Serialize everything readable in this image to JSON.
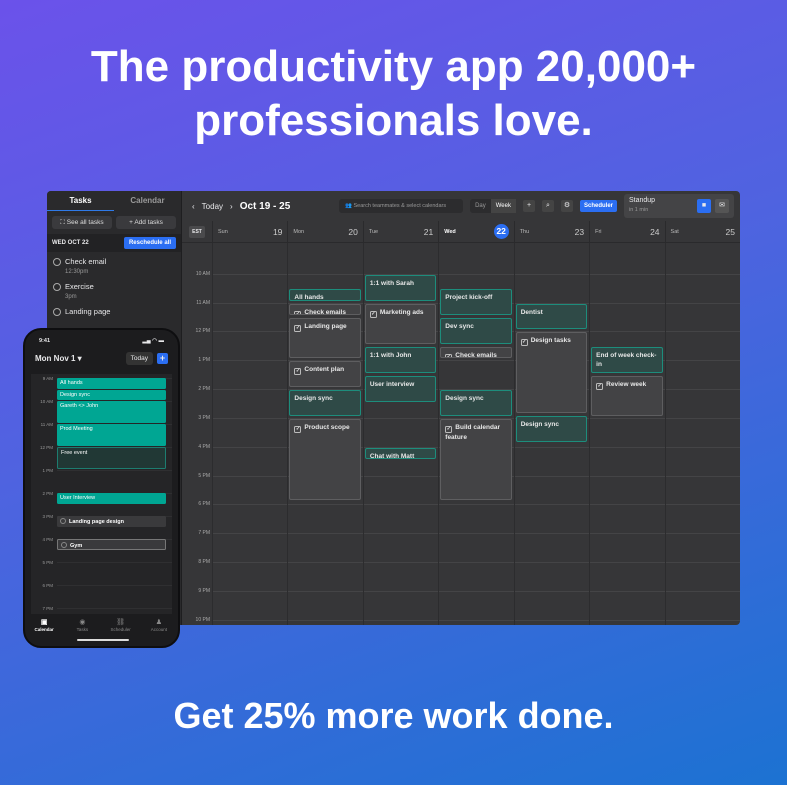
{
  "headline": [
    "The productivity app 20,000+",
    "professionals love."
  ],
  "footer": "Get 25% more work done.",
  "sidebar": {
    "tabs": [
      "Tasks",
      "Calendar"
    ],
    "see_all": "See all tasks",
    "add": "Add tasks",
    "date": "WED OCT 22",
    "reschedule": "Reschedule all",
    "tasks": [
      {
        "title": "Check email",
        "time": "12:30pm"
      },
      {
        "title": "Exercise",
        "time": "3pm"
      },
      {
        "title": "Landing page",
        "time": ""
      }
    ]
  },
  "toolbar": {
    "today": "Today",
    "range": "Oct 19 - 25",
    "search_placeholder": "Search teammates & select calendars",
    "day": "Day",
    "week": "Week",
    "scheduler": "Scheduler",
    "next_event": {
      "title": "Standup",
      "when": "in 1 min"
    }
  },
  "calendar": {
    "timezone": "EST",
    "days": [
      {
        "name": "Sun",
        "num": "19"
      },
      {
        "name": "Mon",
        "num": "20"
      },
      {
        "name": "Tue",
        "num": "21"
      },
      {
        "name": "Wed",
        "num": "22",
        "today": true
      },
      {
        "name": "Thu",
        "num": "23"
      },
      {
        "name": "Fri",
        "num": "24"
      },
      {
        "name": "Sat",
        "num": "25"
      }
    ],
    "hours": [
      "10 AM",
      "11 AM",
      "12 PM",
      "1 PM",
      "2 PM",
      "3 PM",
      "4 PM",
      "5 PM",
      "6 PM",
      "7 PM",
      "8 PM",
      "9 PM",
      "10 PM"
    ],
    "events": [
      {
        "day": 1,
        "title": "All hands",
        "start": 10.5,
        "end": 11,
        "kind": "meeting"
      },
      {
        "day": 1,
        "title": "Check emails",
        "start": 11,
        "end": 11.5,
        "kind": "task"
      },
      {
        "day": 1,
        "title": "Landing page",
        "start": 11.5,
        "end": 13,
        "kind": "task"
      },
      {
        "day": 1,
        "title": "Content plan",
        "start": 13,
        "end": 14,
        "kind": "task"
      },
      {
        "day": 1,
        "title": "Design sync",
        "start": 14,
        "end": 15,
        "kind": "meeting"
      },
      {
        "day": 1,
        "title": "Product scope",
        "start": 15,
        "end": 17.9,
        "kind": "task"
      },
      {
        "day": 2,
        "title": "1:1 with Sarah",
        "start": 10,
        "end": 11,
        "kind": "meeting"
      },
      {
        "day": 2,
        "title": "Marketing ads",
        "start": 11,
        "end": 12.5,
        "kind": "task"
      },
      {
        "day": 2,
        "title": "1:1 with John",
        "start": 12.5,
        "end": 13.5,
        "kind": "meeting"
      },
      {
        "day": 2,
        "title": "User interview",
        "start": 13.5,
        "end": 14.5,
        "kind": "meeting"
      },
      {
        "day": 2,
        "title": "Chat with Matt",
        "start": 16,
        "end": 16.5,
        "kind": "meeting"
      },
      {
        "day": 3,
        "title": "Project kick-off",
        "start": 10.5,
        "end": 11.5,
        "kind": "meeting"
      },
      {
        "day": 3,
        "title": "Dev sync",
        "start": 11.5,
        "end": 12.5,
        "kind": "meeting"
      },
      {
        "day": 3,
        "title": "Check emails",
        "start": 12.5,
        "end": 13,
        "kind": "task"
      },
      {
        "day": 3,
        "title": "Design sync",
        "start": 14,
        "end": 15,
        "kind": "meeting"
      },
      {
        "day": 3,
        "title": "Build calendar feature",
        "start": 15,
        "end": 17.9,
        "kind": "task"
      },
      {
        "day": 4,
        "title": "Dentist",
        "start": 11,
        "end": 12,
        "kind": "meeting"
      },
      {
        "day": 4,
        "title": "Design tasks",
        "start": 12,
        "end": 14.9,
        "kind": "task"
      },
      {
        "day": 4,
        "title": "Design sync",
        "start": 14.9,
        "end": 15.9,
        "kind": "meeting"
      },
      {
        "day": 5,
        "title": "End of week check-in",
        "start": 12.5,
        "end": 13.5,
        "kind": "meeting"
      },
      {
        "day": 5,
        "title": "Review week",
        "start": 13.5,
        "end": 15,
        "kind": "task"
      }
    ]
  },
  "phone": {
    "time": "9:41",
    "date": "Mon Nov 1",
    "today": "Today",
    "hours": [
      "9 AM",
      "10 AM",
      "11 AM",
      "12 PM",
      "1 PM",
      "2 PM",
      "3 PM",
      "4 PM",
      "5 PM",
      "6 PM",
      "7 PM"
    ],
    "events": [
      {
        "title": "All hands",
        "start": 9,
        "end": 9.5,
        "kind": "g"
      },
      {
        "title": "Design sync",
        "start": 9.5,
        "end": 10,
        "kind": "g"
      },
      {
        "title": "Gareth <> John",
        "start": 10,
        "end": 11,
        "kind": "g"
      },
      {
        "title": "Prod Meeting",
        "start": 11,
        "end": 12,
        "kind": "g"
      },
      {
        "title": "Free event",
        "start": 12,
        "end": 13,
        "kind": "f"
      },
      {
        "title": "User Interview",
        "start": 14,
        "end": 14.5,
        "kind": "g"
      },
      {
        "title": "Landing page design",
        "start": 15,
        "end": 15.5,
        "kind": "k"
      },
      {
        "title": "Gym",
        "start": 16,
        "end": 16.5,
        "kind": "k o"
      }
    ],
    "nav": [
      {
        "label": "Calendar",
        "icon": "calendar-icon",
        "glyph": "▣"
      },
      {
        "label": "Tasks",
        "icon": "check-circle-icon",
        "glyph": "◉"
      },
      {
        "label": "Scheduler",
        "icon": "link-icon",
        "glyph": "⛓"
      },
      {
        "label": "Account",
        "icon": "person-icon",
        "glyph": "♟"
      }
    ]
  },
  "colors": {
    "accent": "#2b6ef2",
    "meeting": "#1d8d7c",
    "phone_event": "#00a693"
  }
}
